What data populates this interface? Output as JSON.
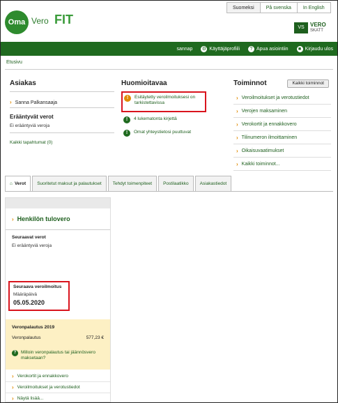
{
  "languages": [
    {
      "label": "Suomeksi",
      "active": true
    },
    {
      "label": "På svenska",
      "active": false
    },
    {
      "label": "In English",
      "active": false
    }
  ],
  "logo": {
    "oma": "Oma",
    "vero": "Vero",
    "fit": "FIT"
  },
  "brand": {
    "line1": "VERO",
    "line2": "SKATT",
    "emblem": "VS"
  },
  "topnav": {
    "user": "sannap",
    "profile": "Käyttäjäprofiili",
    "help": "Apua asiointiin",
    "logout": "Kirjaudu ulos"
  },
  "breadcrumb": "Etusivu",
  "asiakas": {
    "title": "Asiakas",
    "customer": "Sanna Palkansaaja",
    "due_title": "Erääntyvät verot",
    "due_text": "Ei erääntyviä veroja",
    "all_events": "Kaikki tapahtumat (0)"
  },
  "huomioitavaa": {
    "title": "Huomioitavaa",
    "items": [
      {
        "text": "Esitäytetty veroilmoituksesi on tarkistettavissa",
        "type": "warning"
      },
      {
        "text": "4 lukematonta kirjettä",
        "type": "info"
      },
      {
        "text": "Omat yhteystietosi puuttuvat",
        "type": "info"
      }
    ]
  },
  "toiminnot": {
    "title": "Toiminnot",
    "all_button": "Kaikki toiminnot",
    "items": [
      "Veroilmoitukset ja verotustiedot",
      "Verojen maksaminen",
      "Verokortit ja ennakkovero",
      "Tilinumeron ilmoittaminen",
      "Oikaisuvaatimukset",
      "Kaikki toiminnot..."
    ]
  },
  "tabs": [
    {
      "label": "Verot",
      "active": true
    },
    {
      "label": "Suoritetut maksut ja palautukset",
      "active": false
    },
    {
      "label": "Tehdyt toimenpiteet",
      "active": false
    },
    {
      "label": "Postilaatikko",
      "active": false
    },
    {
      "label": "Asiakastiedot",
      "active": false
    }
  ],
  "card": {
    "title": "Henkilön tulovero",
    "upcoming_title": "Seuraavat verot",
    "upcoming_text": "Ei erääntyviä veroja",
    "next_return_title": "Seuraava veroilmoitus",
    "due_label": "Määräpäivä",
    "due_date": "05.05.2020",
    "refund": {
      "title": "Veronpalautus 2019",
      "label": "Veronpalautus",
      "amount": "577,23 €",
      "question": "Milloin veronpalautus tai jäännösvero maksetaan?"
    },
    "links": [
      "Verokortit ja ennakkovero",
      "Veroilmoitukset ja verotustiedot",
      "Näytä lisää..."
    ]
  },
  "colors": {
    "brand_green": "#1f6a1f",
    "highlight_red": "#d9141d",
    "warning_orange": "#e08a00",
    "refund_bg": "#fdf0c4"
  }
}
